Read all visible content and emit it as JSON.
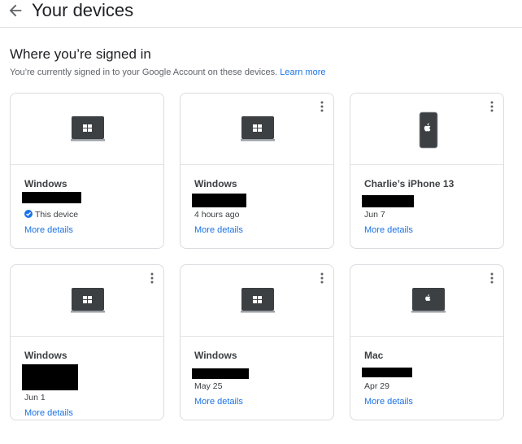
{
  "header": {
    "title": "Your devices"
  },
  "section": {
    "title": "Where you’re signed in",
    "description": "You’re currently signed in to your Google Account on these devices.",
    "learn_more": "Learn more"
  },
  "devices": [
    {
      "name": "Windows",
      "status": "This device",
      "more": "More details",
      "icon": "windows-laptop-icon",
      "has_menu": false
    },
    {
      "name": "Windows",
      "status": "4 hours ago",
      "more": "More details",
      "icon": "windows-laptop-icon",
      "has_menu": true
    },
    {
      "name": "Charlie’s iPhone 13",
      "status": "Jun 7",
      "more": "More details",
      "icon": "iphone-icon",
      "has_menu": true
    },
    {
      "name": "Windows",
      "status": "Jun 1",
      "more": "More details",
      "icon": "windows-laptop-icon",
      "has_menu": true
    },
    {
      "name": "Windows",
      "status": "May 25",
      "more": "More details",
      "icon": "windows-laptop-icon",
      "has_menu": true
    },
    {
      "name": "Mac",
      "status": "Apr 29",
      "more": "More details",
      "icon": "mac-laptop-icon",
      "has_menu": true
    }
  ],
  "colors": {
    "accent": "#1a73e8",
    "border": "#dadce0",
    "device_dark": "#3c4043",
    "redaction": "#000000"
  }
}
